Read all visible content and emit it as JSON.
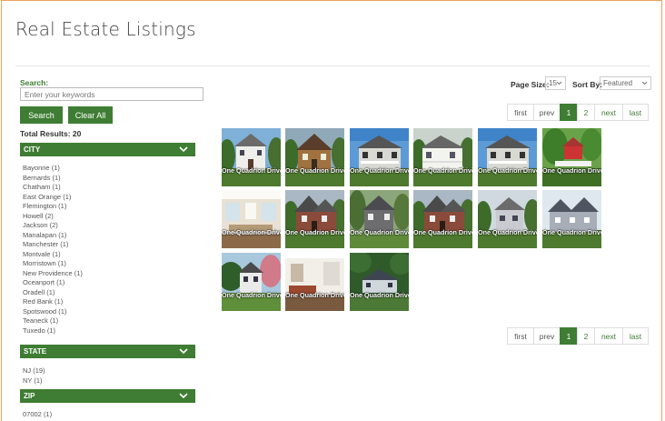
{
  "page": {
    "title": "Real Estate Listings"
  },
  "search": {
    "label": "Search:",
    "placeholder": "Enter your keywords",
    "value": "",
    "search_button": "Search",
    "clear_button": "Clear All",
    "total_results": "Total Results: 20"
  },
  "facets": {
    "city": {
      "label": "CITY",
      "items": [
        "Bayonne (1)",
        "Bernards (1)",
        "Chatham (1)",
        "East Orange (1)",
        "Flemington (1)",
        "Howell (2)",
        "Jackson (2)",
        "Manalapan (1)",
        "Manchester (1)",
        "Montvale (1)",
        "Morristown (1)",
        "New Providence (1)",
        "Oceanport (1)",
        "Oradell (1)",
        "Red Bank (1)",
        "Spotswood (1)",
        "Teaneck (1)",
        "Tuxedo (1)"
      ]
    },
    "state": {
      "label": "STATE",
      "items": [
        "NJ (19)",
        "NY (1)"
      ]
    },
    "zip": {
      "label": "ZIP",
      "items": [
        "07002 (1)"
      ]
    }
  },
  "toolbar": {
    "page_size_label": "Page Size:",
    "page_size_value": "15",
    "sort_label": "Sort By:",
    "sort_value": "Featured"
  },
  "pagination": {
    "first": "first",
    "prev": "prev",
    "pages": [
      "1",
      "2"
    ],
    "active": "1",
    "next": "next",
    "last": "last"
  },
  "listings": [
    {
      "caption": "One Quadrion Drive",
      "scene": "white-colonial"
    },
    {
      "caption": "One Quadrion Drive",
      "scene": "brown-tudor"
    },
    {
      "caption": "One Quadrion Drive",
      "scene": "gray-colonial"
    },
    {
      "caption": "One Quadrion Drive",
      "scene": "farmhouse"
    },
    {
      "caption": "One Quadrion Drive",
      "scene": "gray-colonial"
    },
    {
      "caption": "One Quadrion Drive",
      "scene": "gazebo"
    },
    {
      "caption": "One Quadrion Drive",
      "scene": "interior-living"
    },
    {
      "caption": "One Quadrion Drive",
      "scene": "brick-tudor"
    },
    {
      "caption": "One Quadrion Drive",
      "scene": "shingle-house"
    },
    {
      "caption": "One Quadrion Drive",
      "scene": "brick-tudor"
    },
    {
      "caption": "One Quadrion Drive",
      "scene": "cottage"
    },
    {
      "caption": "One Quadrion Drive",
      "scene": "large-gray"
    },
    {
      "caption": "One Quadrion Drive",
      "scene": "blossom-house"
    },
    {
      "caption": "One Quadrion Drive",
      "scene": "interior-room"
    },
    {
      "caption": "One Quadrion Drive",
      "scene": "aerial-house"
    }
  ],
  "colors": {
    "accent": "#3e7d33",
    "frame": "#f0a05a"
  }
}
